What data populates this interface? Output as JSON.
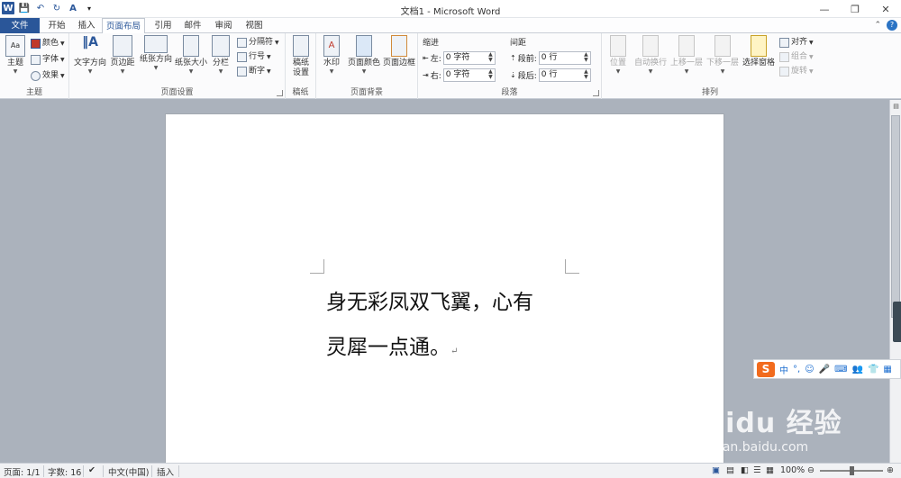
{
  "app": {
    "title": "文档1 - Microsoft Word",
    "window_controls": [
      "—",
      "❐",
      "✕"
    ]
  },
  "qat": {
    "logo": "W",
    "save": "💾",
    "undo": "↶",
    "redo": "↻",
    "format": "A",
    "customize": "▾"
  },
  "tabs": [
    {
      "label": "文件",
      "state": "file"
    },
    {
      "label": "开始"
    },
    {
      "label": "插入"
    },
    {
      "label": "页面布局",
      "state": "active"
    },
    {
      "label": "引用"
    },
    {
      "label": "邮件"
    },
    {
      "label": "审阅"
    },
    {
      "label": "视图"
    }
  ],
  "help": {
    "minimize": "⌃",
    "help": "?"
  },
  "ribbon": {
    "theme": {
      "group_label": "主题",
      "theme_btn": "主题",
      "colors": "颜色",
      "fonts": "字体",
      "effects": "效果"
    },
    "page_setup": {
      "group_label": "页面设置",
      "text_direction": "文字方向",
      "margins": "页边距",
      "orientation": "纸张方向",
      "size": "纸张大小",
      "columns": "分栏",
      "breaks": "分隔符",
      "line_numbers": "行号",
      "hyphenation": "断字"
    },
    "manuscript": {
      "group_label": "稿纸",
      "setup_line1": "稿纸",
      "setup_line2": "设置"
    },
    "page_background": {
      "group_label": "页面背景",
      "watermark": "水印",
      "page_color": "页面颜色",
      "page_borders": "页面边框"
    },
    "paragraph": {
      "group_label": "段落",
      "indent_title": "缩进",
      "spacing_title": "间距",
      "left_label": "左:",
      "left_value": "0 字符",
      "right_label": "右:",
      "right_value": "0 字符",
      "before_label": "段前:",
      "before_value": "0 行",
      "after_label": "段后:",
      "after_value": "0 行"
    },
    "arrange": {
      "group_label": "排列",
      "position": "位置",
      "wrap_text": "自动换行",
      "bring_forward": "上移一层",
      "send_backward": "下移一层",
      "selection_pane": "选择窗格",
      "align": "对齐",
      "group": "组合",
      "rotate": "旋转"
    }
  },
  "document": {
    "line1": "身无彩凤双飞翼，心有",
    "line2": "灵犀一点通。",
    "paragraph_mark": "↵"
  },
  "ime": {
    "logo": "S",
    "mode": "中",
    "punct": "°,",
    "emoji": "☺",
    "voice": "🎤",
    "keyboard": "⌨",
    "user": "👥",
    "skin": "👕",
    "tools": "▦"
  },
  "watermark": {
    "main": "Baidu 经验",
    "sub": "jingyan.baidu.com"
  },
  "statusbar": {
    "page": "页面: 1/1",
    "words": "字数: 16",
    "language": "中文(中国)",
    "insert": "插入",
    "zoom": "100%",
    "zoom_out": "⊖",
    "zoom_in": "⊕"
  }
}
